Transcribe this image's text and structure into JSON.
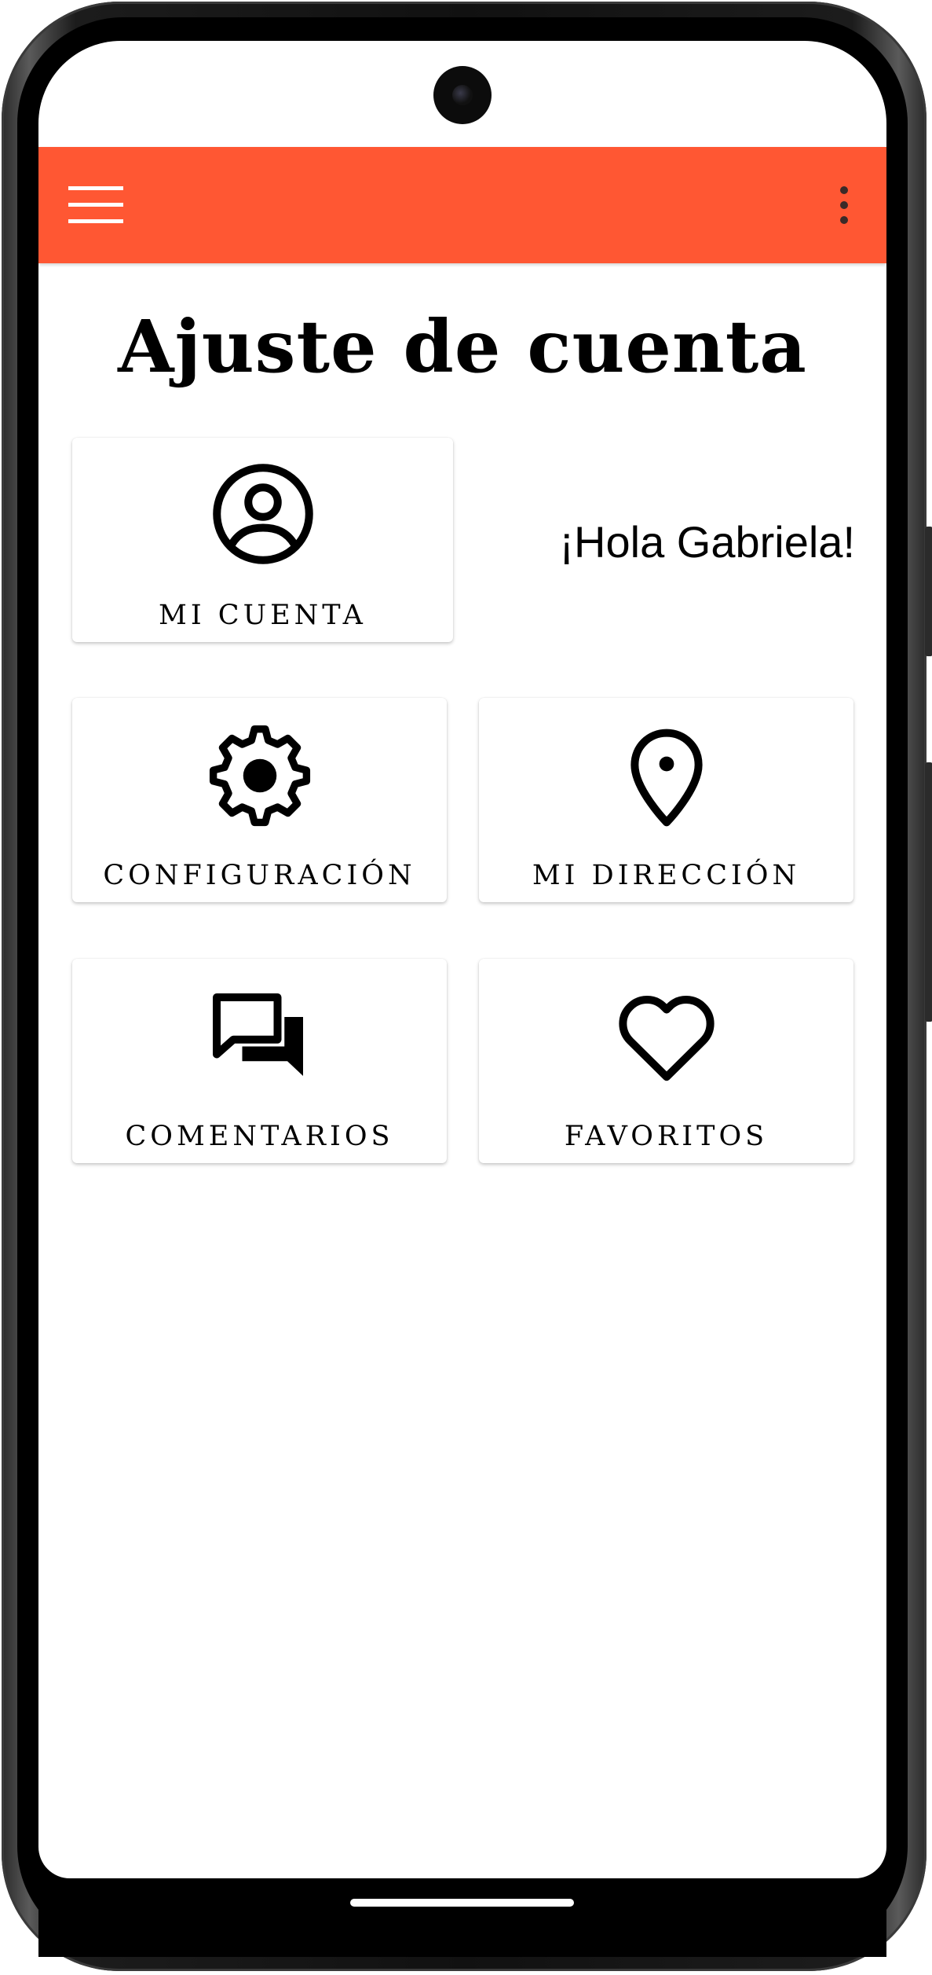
{
  "header": {
    "menu_icon": "menu-icon",
    "overflow_icon": "more-vert-icon",
    "color": "#ff5733"
  },
  "main": {
    "title": "Ajuste de cuenta",
    "greeting": "¡Hola Gabriela!",
    "cards": [
      {
        "label": "MI CUENTA",
        "icon": "account-circle-icon"
      },
      {
        "label": "CONFIGURACIÓN",
        "icon": "gear-icon"
      },
      {
        "label": "MI DIRECCIÓN",
        "icon": "location-pin-icon"
      },
      {
        "label": "COMENTARIOS",
        "icon": "chat-bubbles-icon"
      },
      {
        "label": "FAVORITOS",
        "icon": "heart-icon"
      }
    ]
  }
}
